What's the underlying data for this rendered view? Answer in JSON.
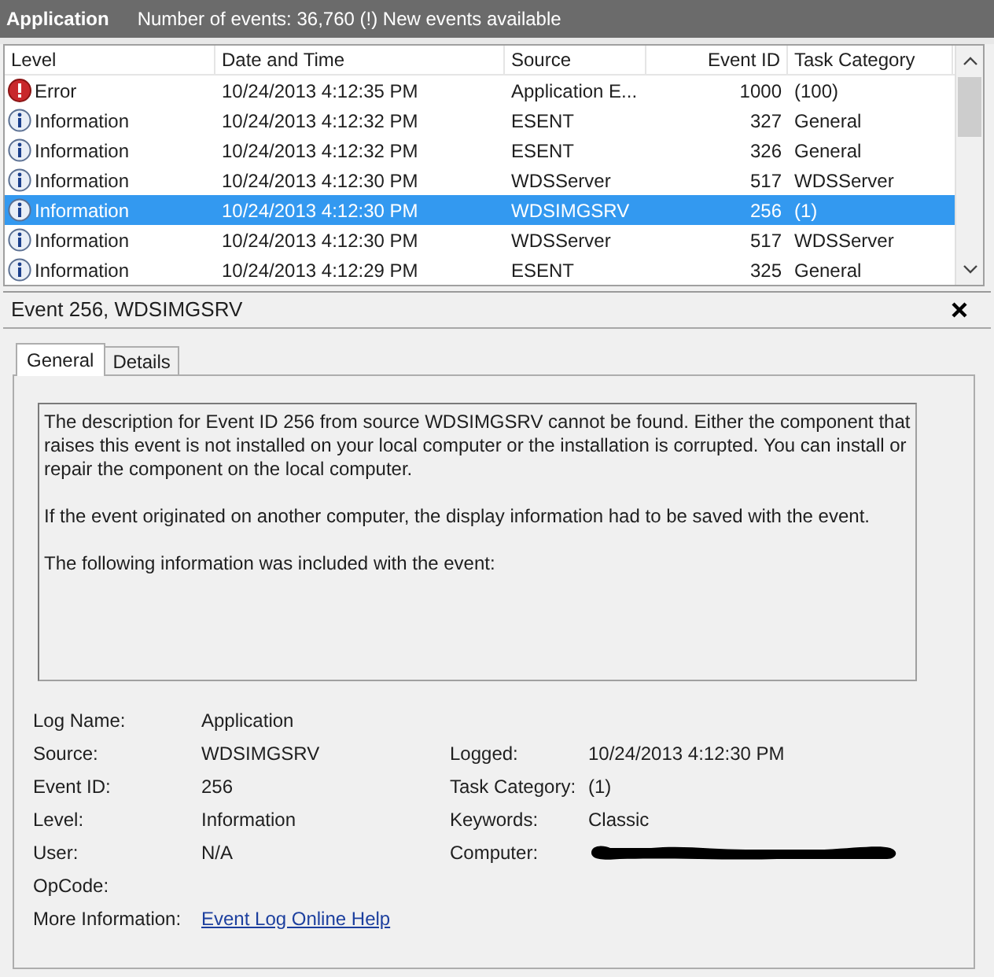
{
  "header": {
    "title": "Application",
    "summary": "Number of events: 36,760 (!) New events available"
  },
  "events": {
    "columns": [
      "Level",
      "Date and Time",
      "Source",
      "Event ID",
      "Task Category"
    ],
    "rows": [
      {
        "kind": "error",
        "level": "Error",
        "date": "10/24/2013 4:12:35 PM",
        "source": "Application E...",
        "event_id": "1000",
        "task_category": "(100)",
        "selected": false
      },
      {
        "kind": "information",
        "level": "Information",
        "date": "10/24/2013 4:12:32 PM",
        "source": "ESENT",
        "event_id": "327",
        "task_category": "General",
        "selected": false
      },
      {
        "kind": "information",
        "level": "Information",
        "date": "10/24/2013 4:12:32 PM",
        "source": "ESENT",
        "event_id": "326",
        "task_category": "General",
        "selected": false
      },
      {
        "kind": "information",
        "level": "Information",
        "date": "10/24/2013 4:12:30 PM",
        "source": "WDSServer",
        "event_id": "517",
        "task_category": "WDSServer",
        "selected": false
      },
      {
        "kind": "information",
        "level": "Information",
        "date": "10/24/2013 4:12:30 PM",
        "source": "WDSIMGSRV",
        "event_id": "256",
        "task_category": "(1)",
        "selected": true
      },
      {
        "kind": "information",
        "level": "Information",
        "date": "10/24/2013 4:12:30 PM",
        "source": "WDSServer",
        "event_id": "517",
        "task_category": "WDSServer",
        "selected": false
      },
      {
        "kind": "information",
        "level": "Information",
        "date": "10/24/2013 4:12:29 PM",
        "source": "ESENT",
        "event_id": "325",
        "task_category": "General",
        "selected": false
      }
    ]
  },
  "detail": {
    "title": "Event 256, WDSIMGSRV",
    "tabs": [
      {
        "label": "General",
        "selected": true
      },
      {
        "label": "Details",
        "selected": false
      }
    ],
    "description": [
      "The description for Event ID 256 from source WDSIMGSRV cannot be found. Either the component that raises this event is not installed on your local computer or the installation is corrupted. You can install or repair the component on the local computer.",
      "If the event originated on another computer, the display information had to be saved with the event.",
      "The following information was included with the event:"
    ],
    "properties": [
      {
        "left": {
          "label": "Log Name:",
          "value": "Application"
        }
      },
      {
        "left": {
          "label": "Source:",
          "value": "WDSIMGSRV"
        },
        "right": {
          "label": "Logged:",
          "value": "10/24/2013 4:12:30 PM"
        }
      },
      {
        "left": {
          "label": "Event ID:",
          "value": "256"
        },
        "right": {
          "label": "Task Category:",
          "value": "(1)"
        }
      },
      {
        "left": {
          "label": "Level:",
          "value": "Information"
        },
        "right": {
          "label": "Keywords:",
          "value": "Classic"
        }
      },
      {
        "left": {
          "label": "User:",
          "value": "N/A"
        },
        "right": {
          "label": "Computer:",
          "redacted": true
        }
      },
      {
        "left": {
          "label": "OpCode:"
        }
      }
    ],
    "more_information": {
      "label": "More Information:",
      "link": "Event Log Online Help"
    }
  }
}
